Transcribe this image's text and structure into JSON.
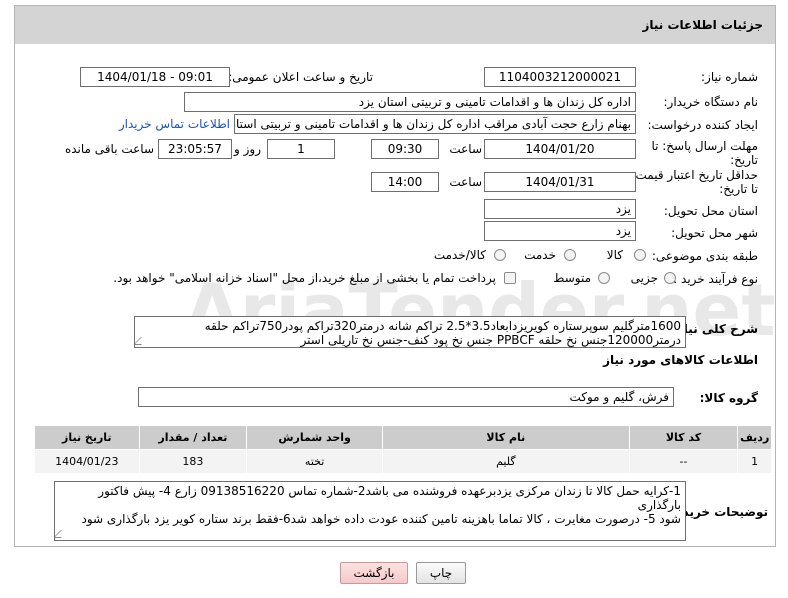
{
  "panel": {
    "title": "جزئیات اطلاعات نیاز"
  },
  "fields": {
    "need_number_label": "شماره نیاز:",
    "need_number": "1104003212000021",
    "announce_label": "تاریخ و ساعت اعلان عمومی:",
    "announce_value": "1404/01/18 - 09:01",
    "buyer_label": "نام دستگاه خریدار:",
    "buyer_value": "اداره کل زندان ها و اقدامات تامینی و تربیتی استان یزد",
    "creator_label": "ایجاد کننده درخواست:",
    "creator_value": "بهنام زارع حجت آبادی مراقب اداره کل زندان ها و اقدامات تامینی و تربیتی استان",
    "contact_link": "اطلاعات تماس خریدار",
    "deadline_label_1": "مهلت ارسال پاسخ: تا",
    "deadline_label_2": "تاریخ:",
    "deadline_date": "1404/01/20",
    "time_label": "ساعت",
    "deadline_time": "09:30",
    "days_value": "1",
    "days_label": "روز و",
    "remaining_time": "23:05:57",
    "remaining_label": "ساعت باقی مانده",
    "price_label_1": "حداقل تاریخ اعتبار قیمت:",
    "price_label_2": "تا تاریخ:",
    "price_date": "1404/01/31",
    "price_time_label": "ساعت",
    "price_time": "14:00",
    "province_label": "استان محل تحویل:",
    "province_value": "یزد",
    "city_label": "شهر محل تحویل:",
    "city_value": "یزد",
    "category_label": "طبقه بندی موضوعی:",
    "category_options": [
      "کالا",
      "خدمت",
      "کالا/خدمت"
    ],
    "process_label": "نوع فرآیند خرید :",
    "process_options": [
      "جزیی",
      "متوسط"
    ],
    "payment_note": "پرداخت تمام یا بخشی از مبلغ خرید،از محل \"اسناد خزانه اسلامی\" خواهد بود.",
    "description_label": "شرح کلی نیاز:",
    "description_line1": "1600مترگلیم سوپرستاره کویریزدابعاد3.5*2.5 تراکم شانه درمتر320تراکم پودر750تراکم حلقه",
    "description_line2": "درمتر120000جنس نخ حلقه PPBCF جنس نخ پود کنف-جنس نخ تاریلی استر",
    "goods_info_title": "اطلاعات کالاهای مورد نیاز",
    "goods_group_label": "گروه کالا:",
    "goods_group_value": "فرش، گلیم و موکت",
    "buyer_notes_label": "توضیحات خریدار:",
    "buyer_notes_line1": "1-کرایه حمل کالا تا زندان مرکزی یزدبرعهده فروشنده می باشد2-شماره تماس 09138516220 زارع  4- پیش فاکتور بارگذاری",
    "buyer_notes_line2": "شود 5- درصورت مغایرت ، کالا تماما باهزینه تامین کننده عودت داده خواهد شد6-فقط برند ستاره کویر یزد بارگذاری شود"
  },
  "table": {
    "headers": [
      "ردیف",
      "کد کالا",
      "نام کالا",
      "واحد شمارش",
      "تعداد / مقدار",
      "تاریخ نیاز"
    ],
    "rows": [
      [
        "1",
        "--",
        "گلیم",
        "تخته",
        "183",
        "1404/01/23"
      ]
    ]
  },
  "buttons": {
    "print": "چاپ",
    "back": "بازگشت"
  },
  "watermark": {
    "text": "AriaTender.net"
  }
}
